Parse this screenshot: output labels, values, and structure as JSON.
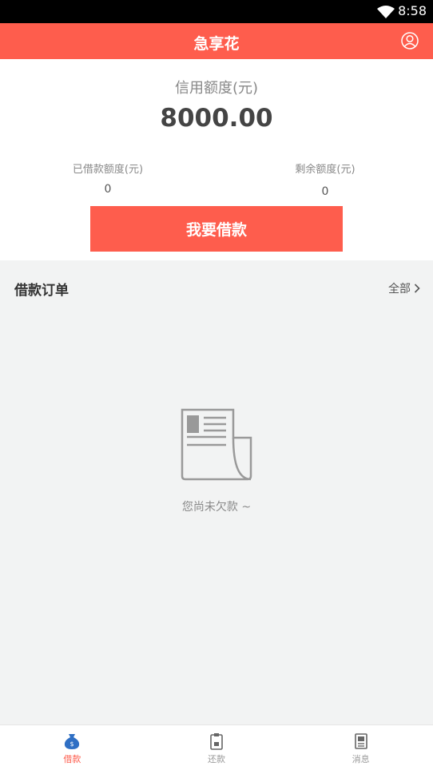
{
  "status_bar": {
    "time": "8:58"
  },
  "app_bar": {
    "title": "急享花"
  },
  "credit": {
    "label": "信用额度(元)",
    "value": "8000.00",
    "borrowed_label": "已借款额度(元)",
    "borrowed_value": "0",
    "remaining_label": "剩余额度(元)",
    "remaining_value": "0"
  },
  "borrow_button": "我要借款",
  "orders": {
    "title": "借款订单",
    "view_all": "全部",
    "empty_message": "您尚未欠款 ~"
  },
  "tabs": [
    {
      "label": "借款",
      "icon": "money-bag-icon"
    },
    {
      "label": "还款",
      "icon": "clipboard-icon"
    },
    {
      "label": "消息",
      "icon": "message-icon"
    }
  ],
  "colors": {
    "accent": "#fe5d4d",
    "background": "#f2f3f3"
  }
}
